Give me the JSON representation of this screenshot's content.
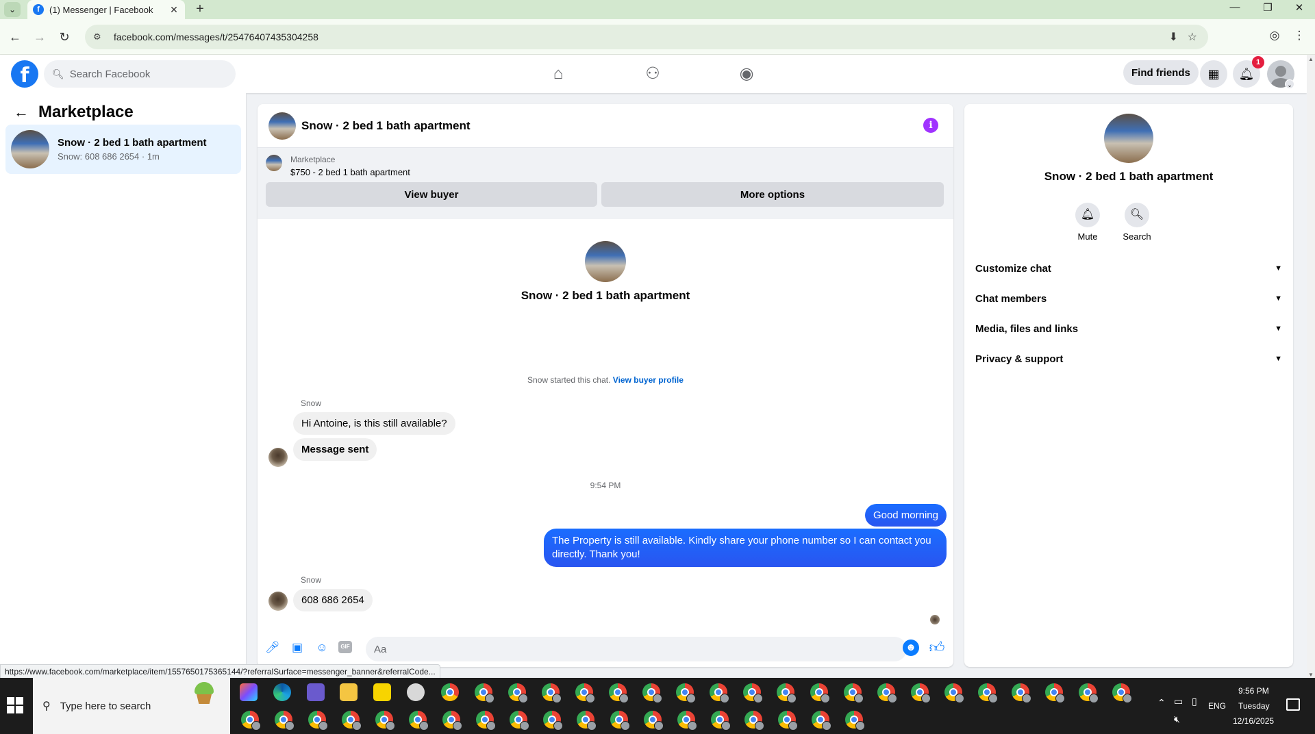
{
  "browser": {
    "tab_title": "(1) Messenger | Facebook",
    "url": "facebook.com/messages/t/25476407435304258",
    "status_url": "https://www.facebook.com/marketplace/item/1557650175365144/?referralSurface=messenger_banner&referralCode..."
  },
  "fb": {
    "search_placeholder": "Search Facebook",
    "find_friends": "Find friends",
    "notifications_count": "1"
  },
  "left": {
    "title": "Marketplace",
    "conversation": {
      "name": "Snow · 2 bed 1 bath apartment",
      "snippet": "Snow: 608 686 2654 · 1m"
    }
  },
  "chat": {
    "title": "Snow · 2 bed 1 bath apartment",
    "banner": {
      "label": "Marketplace",
      "listing": "$750 - 2 bed 1 bath apartment",
      "view_buyer": "View buyer",
      "more_options": "More options"
    },
    "intro_name": "Snow · 2 bed 1 bath apartment",
    "started_text": "Snow started this chat.",
    "view_buyer_profile": "View buyer profile",
    "messages": {
      "sender1": "Snow",
      "m1": "Hi Antoine, is this still available?",
      "m2": "Message sent",
      "time": "9:54 PM",
      "out1": "Good morning",
      "out2": "The Property is still available. Kindly share your phone number so I can contact you directly. Thank you!",
      "sender2": "Snow",
      "m3": "608 686 2654"
    },
    "composer_placeholder": "Aa"
  },
  "right": {
    "name": "Snow · 2 bed 1 bath apartment",
    "mute": "Mute",
    "search": "Search",
    "sections": [
      "Customize chat",
      "Chat members",
      "Media, files and links",
      "Privacy & support"
    ]
  },
  "taskbar": {
    "search_placeholder": "Type here to search",
    "lang": "ENG",
    "time": "9:56 PM",
    "day": "Tuesday",
    "date": "12/16/2025"
  },
  "colors": {
    "fb_blue": "#1877f2",
    "bubble_out": "#2955f0",
    "highlight": "#e7f3ff",
    "info": "#a033ff"
  }
}
